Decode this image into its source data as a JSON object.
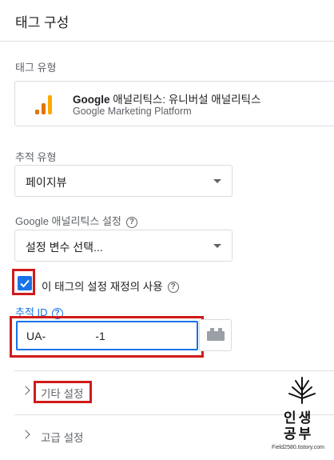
{
  "header": {
    "title": "태그 구성"
  },
  "tag_type": {
    "label": "태그 유형",
    "name_brand": "Google",
    "name_rest": " 애널리틱스: 유니버설 애널리틱스",
    "subtitle": "Google Marketing Platform",
    "icon": "google-analytics-icon",
    "logo_colors": [
      "#f9ab00",
      "#e37400",
      "#e37400"
    ]
  },
  "tracking_type": {
    "label": "추적 유형",
    "value": "페이지뷰"
  },
  "ga_settings": {
    "label": "Google 애널리틱스 설정",
    "value": "설정 변수 선택..."
  },
  "override": {
    "checked": true,
    "label": "이 태그의 설정 재정의 사용"
  },
  "tracking_id": {
    "label": "추적 ID",
    "value": "UA-                -1"
  },
  "sections": [
    {
      "label": "기타 설정"
    },
    {
      "label": "고급 설정"
    }
  ],
  "watermark": {
    "line1": "인생",
    "line2": "공부",
    "url": "Field2580.tistory.com"
  },
  "colors": {
    "accent": "#1a73e8",
    "highlight": "#d01b1b"
  }
}
